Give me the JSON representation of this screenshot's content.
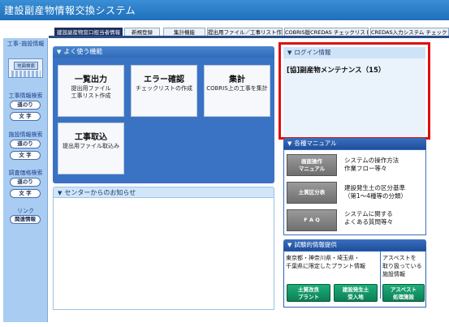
{
  "app": {
    "title": "建設副産物情報交換システム"
  },
  "tabs": [
    {
      "label": "建設副産物窓口担当者情報"
    },
    {
      "label": "新規登録"
    },
    {
      "label": "集計機能"
    },
    {
      "label": "提出用ファイル／工事リスト作成"
    },
    {
      "label": "COBRIS版CREDAS チェックリスト作成"
    },
    {
      "label": "CREDAS入力システム チェックリスト"
    }
  ],
  "sidebar": {
    "map_heading": "工事･施設情報",
    "map_button": "地図検索",
    "sections": [
      {
        "heading": "工事情報検索",
        "buttons": [
          "道のり",
          "文 字"
        ]
      },
      {
        "heading": "施設情報検索",
        "buttons": [
          "道のり",
          "文 字"
        ]
      },
      {
        "heading": "調査価格検索",
        "buttons": [
          "道のり",
          "文 字"
        ]
      },
      {
        "heading": "リンク",
        "buttons": [
          "関連情報"
        ]
      }
    ]
  },
  "quick": {
    "header": "よく使う機能",
    "tiles": [
      {
        "title": "一覧出力",
        "desc": "提出用ファイル\n工事リスト作成"
      },
      {
        "title": "エラー確認",
        "desc": "チェックリストの作成"
      },
      {
        "title": "集計",
        "desc": "COBRIS上の工事を集計"
      },
      {
        "title": "工事取込",
        "desc": "提出用ファイル取込み"
      }
    ]
  },
  "notice": {
    "header": "センターからのお知らせ"
  },
  "login": {
    "header": "ログイン情報",
    "name": "[協]副産物メンテナンス（15）"
  },
  "manual": {
    "header": "各種マニュアル",
    "items": [
      {
        "button": "画面操作\nマニュアル",
        "text": "システムの操作方法\n作業フロー等々"
      },
      {
        "button": "土質区分表",
        "text": "建設発生土の区分基準\n（第1～4種等の分類）"
      },
      {
        "button": "F A Q",
        "text": "システムに関する\nよくある質問等々"
      }
    ]
  },
  "trial": {
    "header": "試験的情報提供",
    "left_text": "東京都・神奈川県・埼玉県・\n千葉県に限定したプラント情報",
    "right_text": "アスベストを\n取り扱っている\n施設情報",
    "buttons": [
      "土質改良\nプラント",
      "建設発生土\n受入地",
      "アスベスト\n処理施設"
    ]
  }
}
